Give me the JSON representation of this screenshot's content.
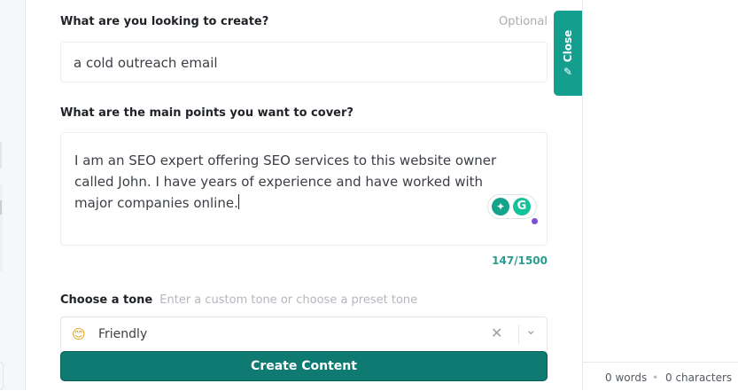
{
  "form": {
    "create_label": "What are you looking to create?",
    "optional_label": "Optional",
    "create_value": "a cold outreach email",
    "points_label": "What are the main points you want to cover?",
    "points_value": "I am an SEO expert offering SEO services to this website owner called John. I have years of experience and have worked with major companies online.",
    "char_counter": "147/1500",
    "tone_label": "Choose a tone",
    "tone_hint": "Enter a custom tone or choose a preset tone",
    "tone_value": "Friendly",
    "tone_emoji": "😊",
    "submit_label": "Create Content"
  },
  "side_tab": {
    "label": "Close",
    "icon": "pencil-icon"
  },
  "status": {
    "words": "0 words",
    "separator": "•",
    "characters": "0 characters"
  },
  "colors": {
    "accent": "#139e8e",
    "button": "#0e7a72",
    "counter": "#2b9b8f"
  }
}
